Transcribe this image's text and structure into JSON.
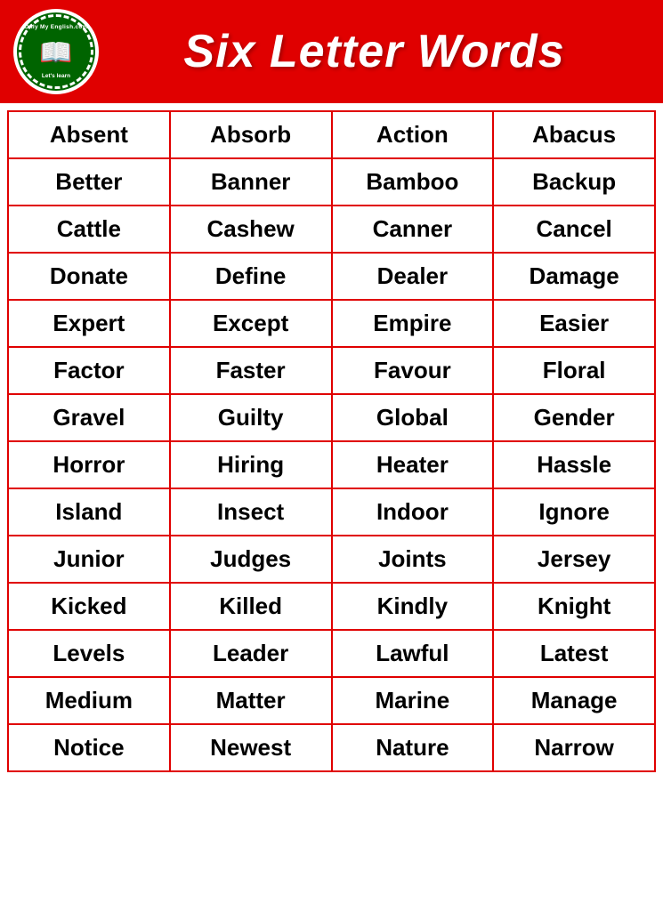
{
  "header": {
    "title": "Six Letter Words",
    "logo": {
      "top_text": "Only My English.com",
      "bottom_text": "Let's learn"
    }
  },
  "table": {
    "rows": [
      [
        "Absent",
        "Absorb",
        "Action",
        "Abacus"
      ],
      [
        "Better",
        "Banner",
        "Bamboo",
        "Backup"
      ],
      [
        "Cattle",
        "Cashew",
        "Canner",
        "Cancel"
      ],
      [
        "Donate",
        "Define",
        "Dealer",
        "Damage"
      ],
      [
        "Expert",
        "Except",
        "Empire",
        "Easier"
      ],
      [
        "Factor",
        "Faster",
        "Favour",
        "Floral"
      ],
      [
        "Gravel",
        "Guilty",
        "Global",
        "Gender"
      ],
      [
        "Horror",
        "Hiring",
        "Heater",
        "Hassle"
      ],
      [
        "Island",
        "Insect",
        "Indoor",
        "Ignore"
      ],
      [
        "Junior",
        "Judges",
        "Joints",
        "Jersey"
      ],
      [
        "Kicked",
        "Killed",
        "Kindly",
        "Knight"
      ],
      [
        "Levels",
        "Leader",
        "Lawful",
        "Latest"
      ],
      [
        "Medium",
        "Matter",
        "Marine",
        "Manage"
      ],
      [
        "Notice",
        "Newest",
        "Nature",
        "Narrow"
      ]
    ]
  }
}
